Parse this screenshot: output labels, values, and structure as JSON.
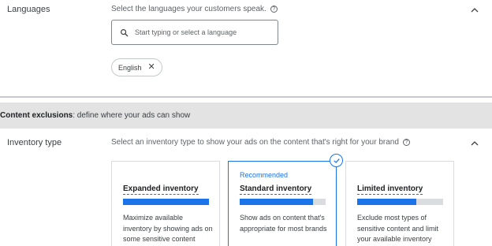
{
  "languages": {
    "label": "Languages",
    "hint": "Select the languages your customers speak.",
    "search": {
      "placeholder": "Start typing or select a language",
      "value": ""
    },
    "chips": [
      {
        "label": "English"
      }
    ]
  },
  "content_exclusions": {
    "header_bold": "Content exclusions",
    "header_rest": ": define where your ads can show"
  },
  "inventory": {
    "label": "Inventory type",
    "hint": "Select an inventory type to show your ads on the content that's right for your brand",
    "cards": [
      {
        "title": "Expanded inventory",
        "badge": "",
        "level": 1.0,
        "selected": false,
        "description": "Maximize available inventory by showing ads on some sensitive content"
      },
      {
        "title": "Standard inventory",
        "badge": "Recommended",
        "level": 0.85,
        "selected": true,
        "description": "Show ads on content that's appropriate for most brands"
      },
      {
        "title": "Limited inventory",
        "badge": "",
        "level": 0.69,
        "selected": false,
        "description": "Exclude most types of sensitive content and limit your available inventory"
      }
    ]
  },
  "colors": {
    "accent": "#1a73e8",
    "header_bg": "#e3e3e3",
    "track": "#dadce0"
  },
  "icons": {
    "search": "search-icon",
    "help": "help-icon",
    "collapse": "chevron-up-icon",
    "chip_remove": "close-icon",
    "selected": "check-circle-icon"
  }
}
